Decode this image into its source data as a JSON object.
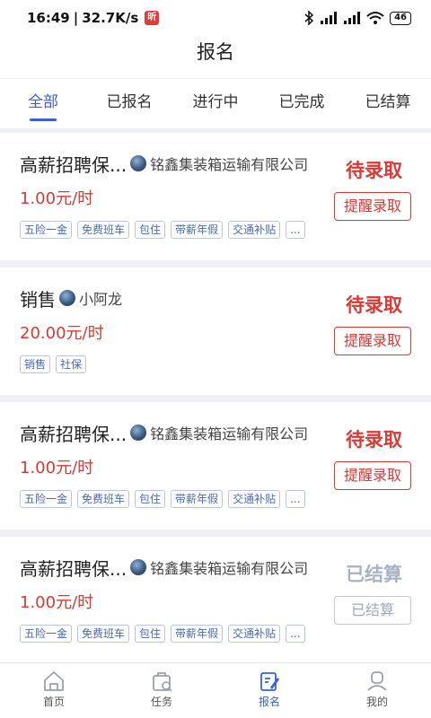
{
  "status_bar": {
    "time": "16:49",
    "speed": "32.7K/s",
    "badge": "昕",
    "battery": "46"
  },
  "header": {
    "title": "报名"
  },
  "tabs": [
    {
      "label": "全部",
      "active": true
    },
    {
      "label": "已报名",
      "active": false
    },
    {
      "label": "进行中",
      "active": false
    },
    {
      "label": "已完成",
      "active": false
    },
    {
      "label": "已结算",
      "active": false
    }
  ],
  "cards": [
    {
      "title": "高薪招聘保...",
      "company": "铭鑫集装箱运输有限公司",
      "salary": "1.00元/时",
      "tags": [
        "五险一金",
        "免费班车",
        "包住",
        "带薪年假",
        "交通补贴",
        "..."
      ],
      "status": "待录取",
      "action": "提醒录取"
    },
    {
      "title": "销售",
      "company": "小阿龙",
      "salary": "20.00元/时",
      "tags": [
        "销售",
        "社保"
      ],
      "status": "待录取",
      "action": "提醒录取"
    },
    {
      "title": "高薪招聘保...",
      "company": "铭鑫集装箱运输有限公司",
      "salary": "1.00元/时",
      "tags": [
        "五险一金",
        "免费班车",
        "包住",
        "带薪年假",
        "交通补贴",
        "..."
      ],
      "status": "待录取",
      "action": "提醒录取"
    },
    {
      "title": "高薪招聘保...",
      "company": "铭鑫集装箱运输有限公司",
      "salary": "1.00元/时",
      "tags": [
        "五险一金",
        "免费班车",
        "包住",
        "带薪年假",
        "交通补贴",
        "..."
      ],
      "status": "已结算",
      "action": "已结算"
    }
  ],
  "bottom_nav": [
    {
      "label": "首页",
      "icon": "home-icon",
      "active": false
    },
    {
      "label": "任务",
      "icon": "task-icon",
      "active": false
    },
    {
      "label": "报名",
      "icon": "signup-icon",
      "active": true
    },
    {
      "label": "我的",
      "icon": "profile-icon",
      "active": false
    }
  ],
  "colors": {
    "accent": "#3a5fd8",
    "status_red": "#d83a35",
    "status_done": "#aab3c4"
  }
}
